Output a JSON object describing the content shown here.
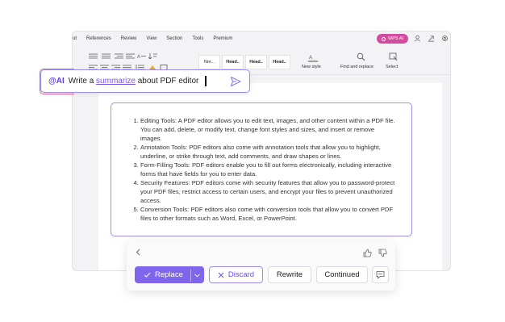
{
  "menu": {
    "items": [
      "ut",
      "References",
      "Review",
      "View",
      "Section",
      "Tools",
      "Premium"
    ],
    "wps_ai_label": "WPS AI"
  },
  "ribbon": {
    "styles": [
      "Nor...",
      "Head..",
      "Head..",
      "Head.."
    ],
    "new_style_label": "New style",
    "find_replace_label": "Find and replace",
    "select_label": "Select"
  },
  "ai_prompt": {
    "tag": "@AI",
    "text_before": "Write a",
    "link_text": "summarize",
    "text_after": "about PDF editor"
  },
  "result": {
    "items": [
      "Editing Tools: A PDF editor allows you to edit text, images, and other content within a PDF file. You can add, delete, or modify text, change font styles and sizes, and insert or remove images.",
      "Annotation Tools: PDF editors also come with annotation tools that allow you to highlight, underline, or strike through text, add comments, and draw shapes or lines.",
      "Form-Filling Tools: PDF editors enable you to fill out forms electronically, including interactive forms that have fields for you to enter data.",
      "Security Features: PDF editors come with security features that allow you to password-protect your PDF files, restrict access to certain users, and encrypt your files to prevent unauthorized access.",
      "Conversion Tools: PDF editors also come with conversion tools that allow you to convert PDF files to other formats such as Word, Excel, or PowerPoint."
    ]
  },
  "actions": {
    "replace_label": "Replace",
    "discard_label": "Discard",
    "rewrite_label": "Rewrite",
    "continued_label": "Continued"
  },
  "colors": {
    "accent": "#7f64ec",
    "ai_tag": "#5f3fd0",
    "wps_ai_badge": "#d34d9e"
  },
  "icons": [
    "send-icon",
    "back-icon",
    "thumbs-up-icon",
    "thumbs-down-icon",
    "check-icon",
    "chevron-down-icon",
    "close-icon",
    "comment-icon",
    "search-icon",
    "select-icon",
    "new-style-icon",
    "user-icon",
    "share-icon",
    "settings-icon"
  ]
}
